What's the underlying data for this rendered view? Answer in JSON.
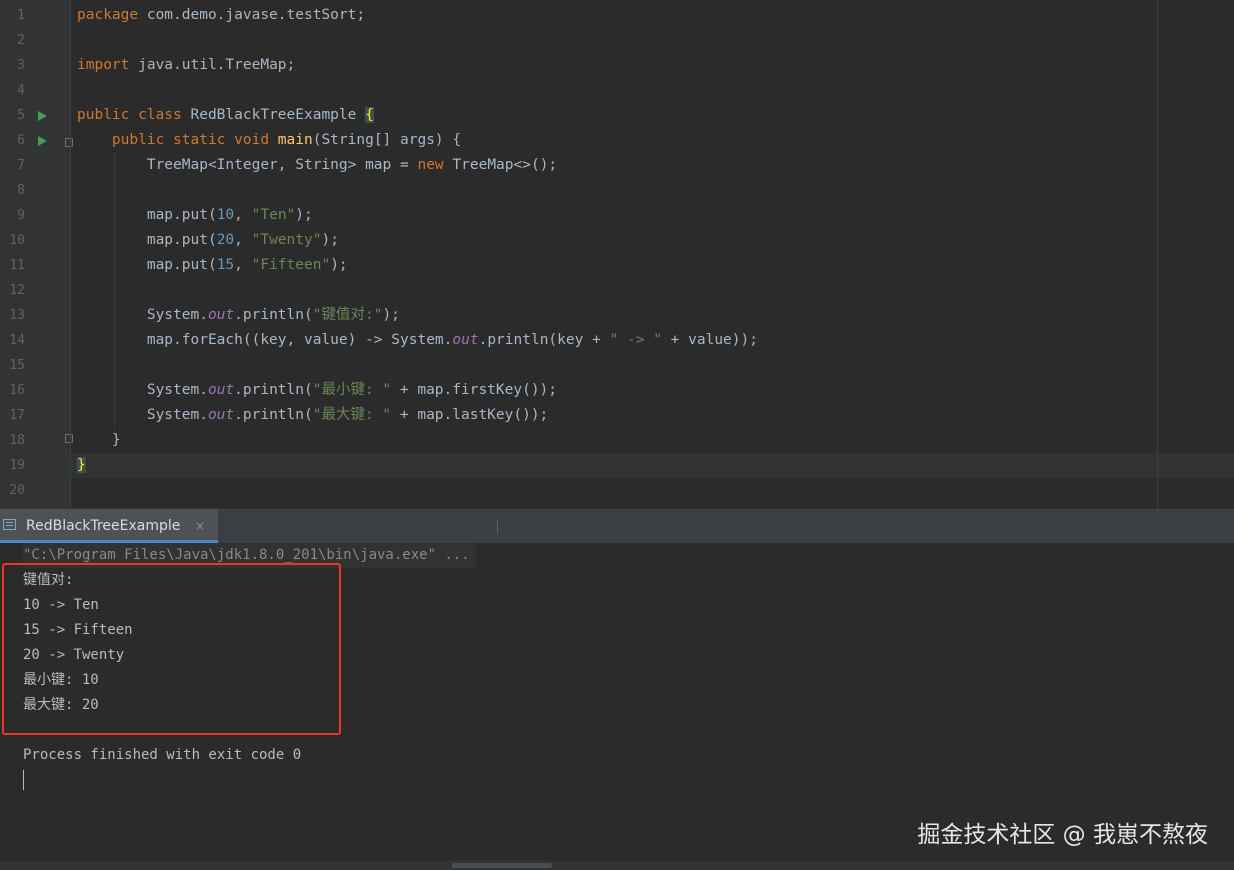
{
  "editor": {
    "line_numbers": [
      "1",
      "2",
      "3",
      "4",
      "5",
      "6",
      "7",
      "8",
      "9",
      "10",
      "11",
      "12",
      "13",
      "14",
      "15",
      "16",
      "17",
      "18",
      "19",
      "20"
    ],
    "code": {
      "l1_kw": "package",
      "l1_rest": " com.demo.javase.testSort;",
      "l3_kw": "import",
      "l3_rest": " java.util.TreeMap;",
      "l5_kw": "public class",
      "l5_name": " RedBlackTreeExample ",
      "l5_brace": "{",
      "l6_indent": "    ",
      "l6_kw": "public static void",
      "l6_sp": " ",
      "l6_fn": "main",
      "l6_rest": "(String[] args) {",
      "l7_a": "        TreeMap<Integer, String> map = ",
      "l7_kw": "new",
      "l7_b": " TreeMap<>();",
      "l9_a": "        map.put(",
      "l9_num": "10",
      "l9_comma": ", ",
      "l9_str": "\"Ten\"",
      "l9_end": ");",
      "l10_a": "        map.put(",
      "l10_num": "20",
      "l10_comma": ", ",
      "l10_str": "\"Twenty\"",
      "l10_end": ");",
      "l11_a": "        map.put(",
      "l11_num": "15",
      "l11_comma": ", ",
      "l11_str": "\"Fifteen\"",
      "l11_end": ");",
      "l13_a": "        System.",
      "l13_out": "out",
      "l13_b": ".println(",
      "l13_str": "\"键值对:\"",
      "l13_end": ");",
      "l14_a": "        map.forEach((key, value) -> System.",
      "l14_out": "out",
      "l14_b": ".println(key + ",
      "l14_str": "\" -> \"",
      "l14_end": " + value));",
      "l16_a": "        System.",
      "l16_out": "out",
      "l16_b": ".println(",
      "l16_str": "\"最小键: \"",
      "l16_end": " + map.firstKey());",
      "l17_a": "        System.",
      "l17_out": "out",
      "l17_b": ".println(",
      "l17_str": "\"最大键: \"",
      "l17_end": " + map.lastKey());",
      "l18": "    }",
      "l19_brace": "}"
    }
  },
  "run_panel": {
    "tab_label": "RedBlackTreeExample",
    "tab_close": "×",
    "tab_icon": "console-icon"
  },
  "console": {
    "command": "\"C:\\Program Files\\Java\\jdk1.8.0_201\\bin\\java.exe\" ...",
    "output": [
      "键值对:",
      "10 -> Ten",
      "15 -> Fifteen",
      "20 -> Twenty",
      "最小键: 10",
      "最大键: 20"
    ],
    "exit_message": "Process finished with exit code 0"
  },
  "watermark": "掘金技术社区 @ 我崽不熬夜",
  "colors": {
    "background": "#2b2b2b",
    "keyword": "#cc7832",
    "string": "#6a8759",
    "number": "#6897bb",
    "method": "#ffc66d",
    "field": "#9876aa",
    "highlight_box": "#e8362f"
  }
}
